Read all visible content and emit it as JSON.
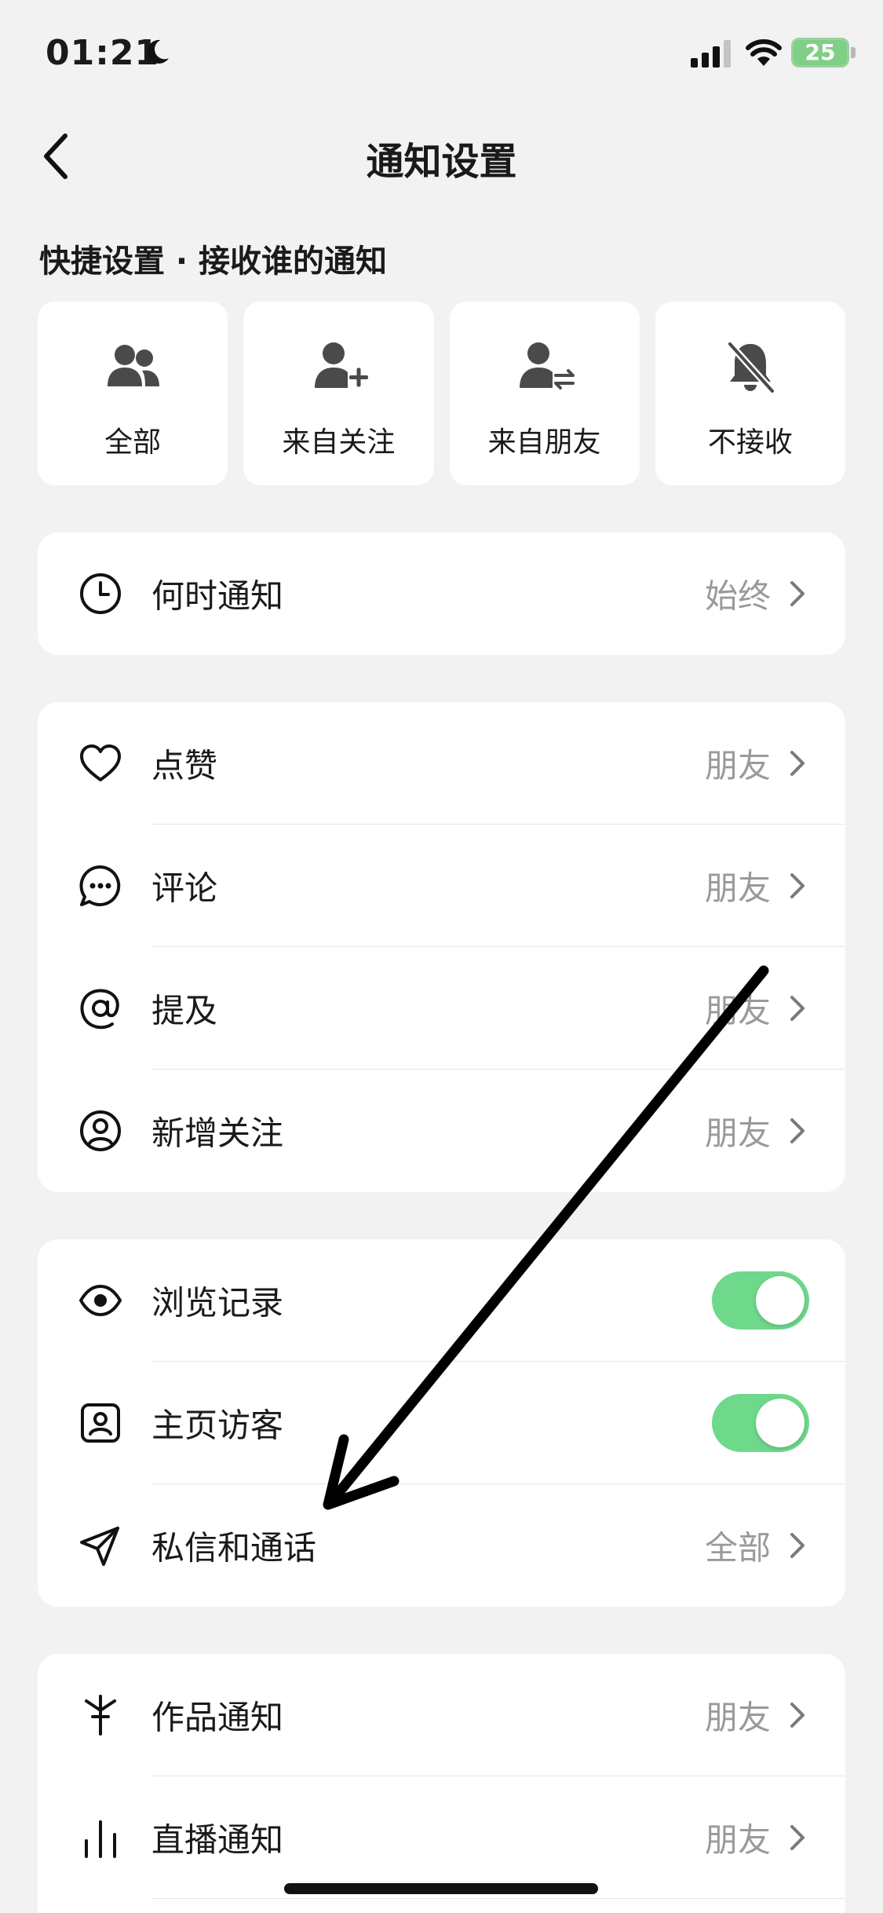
{
  "status_bar": {
    "time": "01:21",
    "battery": "25"
  },
  "nav": {
    "title": "通知设置"
  },
  "quick_settings": {
    "heading": "快捷设置 · 接收谁的通知",
    "items": [
      {
        "label": "全部",
        "icon": "group-icon"
      },
      {
        "label": "来自关注",
        "icon": "user-add-icon"
      },
      {
        "label": "来自朋友",
        "icon": "user-swap-icon"
      },
      {
        "label": "不接收",
        "icon": "bell-off-icon"
      }
    ]
  },
  "when_card": {
    "rows": [
      {
        "label": "何时通知",
        "value": "始终",
        "icon": "clock-icon"
      }
    ]
  },
  "interaction_card": {
    "rows": [
      {
        "label": "点赞",
        "value": "朋友",
        "icon": "heart-icon"
      },
      {
        "label": "评论",
        "value": "朋友",
        "icon": "comment-icon"
      },
      {
        "label": "提及",
        "value": "朋友",
        "icon": "at-icon"
      },
      {
        "label": "新增关注",
        "value": "朋友",
        "icon": "user-circle-icon"
      }
    ]
  },
  "privacy_card": {
    "rows": [
      {
        "label": "浏览记录",
        "toggle": true,
        "icon": "eye-icon"
      },
      {
        "label": "主页访客",
        "toggle": true,
        "icon": "visitor-icon"
      },
      {
        "label": "私信和通话",
        "value": "全部",
        "icon": "send-icon"
      }
    ]
  },
  "content_card": {
    "rows": [
      {
        "label": "作品通知",
        "value": "朋友",
        "icon": "sparkle-icon"
      },
      {
        "label": "直播通知",
        "value": "朋友",
        "icon": "bars-icon"
      }
    ]
  },
  "colors": {
    "toggle_on": "#6ed98b",
    "background": "#f2f2f2",
    "secondary_text": "#9a9a9a"
  }
}
